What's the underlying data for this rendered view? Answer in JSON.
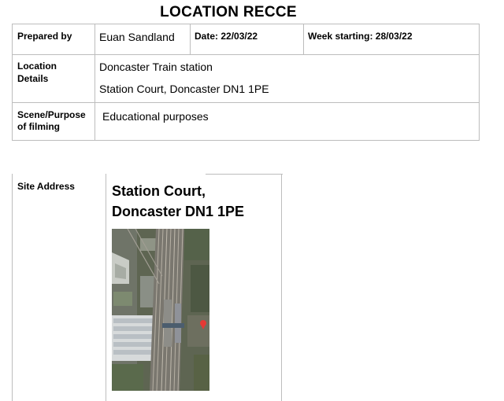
{
  "title": "LOCATION RECCE",
  "table": {
    "prepared_by_label": "Prepared by",
    "prepared_by_value": "Euan Sandland",
    "date": "Date: 22/03/22",
    "week_starting": "Week starting: 28/03/22",
    "location_label_line1": "Location",
    "location_label_line2": "Details",
    "location_line1": "Doncaster Train station",
    "location_line2": "Station Court, Doncaster DN1 1PE",
    "scene_label_line1": "Scene/Purpose",
    "scene_label_line2": "of filming",
    "scene_value": "Educational purposes"
  },
  "site": {
    "label": "Site Address",
    "address_line1": "Station Court,",
    "address_line2": "Doncaster DN1 1PE",
    "image": "aerial-satellite-map",
    "marker_color": "#e53935"
  }
}
